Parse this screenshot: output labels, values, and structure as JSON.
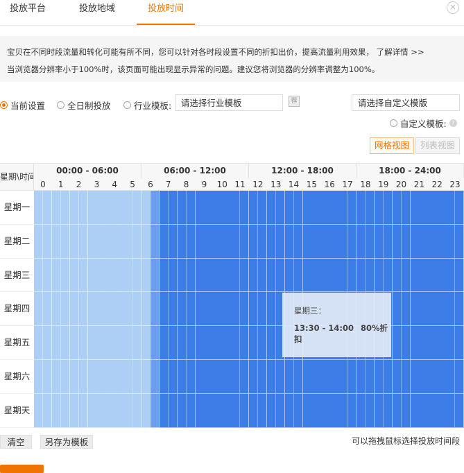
{
  "tabs": [
    {
      "label": "投放平台",
      "active": false
    },
    {
      "label": "投放地域",
      "active": false
    },
    {
      "label": "投放时间",
      "active": true
    }
  ],
  "notice": {
    "line1": "宝贝在不同时段流量和转化可能有所不同，您可以针对各时段设置不同的折扣出价，提高流量利用效果，",
    "link": "了解详情 >>",
    "line2": "当浏览器分辨率小于100%时，该页面可能出现显示异常的问题。建议您将浏览器的分辨率调整为100%。"
  },
  "options": {
    "current": "当前设置",
    "fullday": "全日制投放",
    "industry": "行业模板:",
    "industry_placeholder": "请选择行业模板",
    "rec_badge": "荐",
    "custom_placeholder": "请选择自定义模版",
    "custom": "自定义模板:",
    "selected": "current"
  },
  "view": {
    "grid": "网格视图",
    "list": "列表视图",
    "active": "grid"
  },
  "grid": {
    "corner_label": "星期\\时间",
    "periods": [
      "00:00 - 06:00",
      "06:00 - 12:00",
      "12:00 - 18:00",
      "18:00 - 24:00"
    ],
    "hours": [
      "0",
      "1",
      "2",
      "3",
      "4",
      "5",
      "6",
      "7",
      "8",
      "9",
      "10",
      "11",
      "12",
      "13",
      "14",
      "15",
      "16",
      "17",
      "18",
      "19",
      "20",
      "21",
      "22",
      "23"
    ],
    "days": [
      "星期一",
      "星期二",
      "星期三",
      "星期四",
      "星期五",
      "星期六",
      "星期天"
    ],
    "half_hour_levels": {
      "cols_0_to_12": "light",
      "col_13": "medium",
      "cols_14_to_47": "dark"
    },
    "colors": {
      "light": "#aecff5",
      "medium": "#6b9df0",
      "dark": "#3d7de8"
    }
  },
  "tooltip": {
    "day": "星期三：",
    "time": "13:30 - 14:00",
    "discount": "80%折扣"
  },
  "actions": {
    "clear": "清空",
    "save_template": "另存为模板",
    "hint": "可以拖拽鼠标选择投放时间段"
  }
}
